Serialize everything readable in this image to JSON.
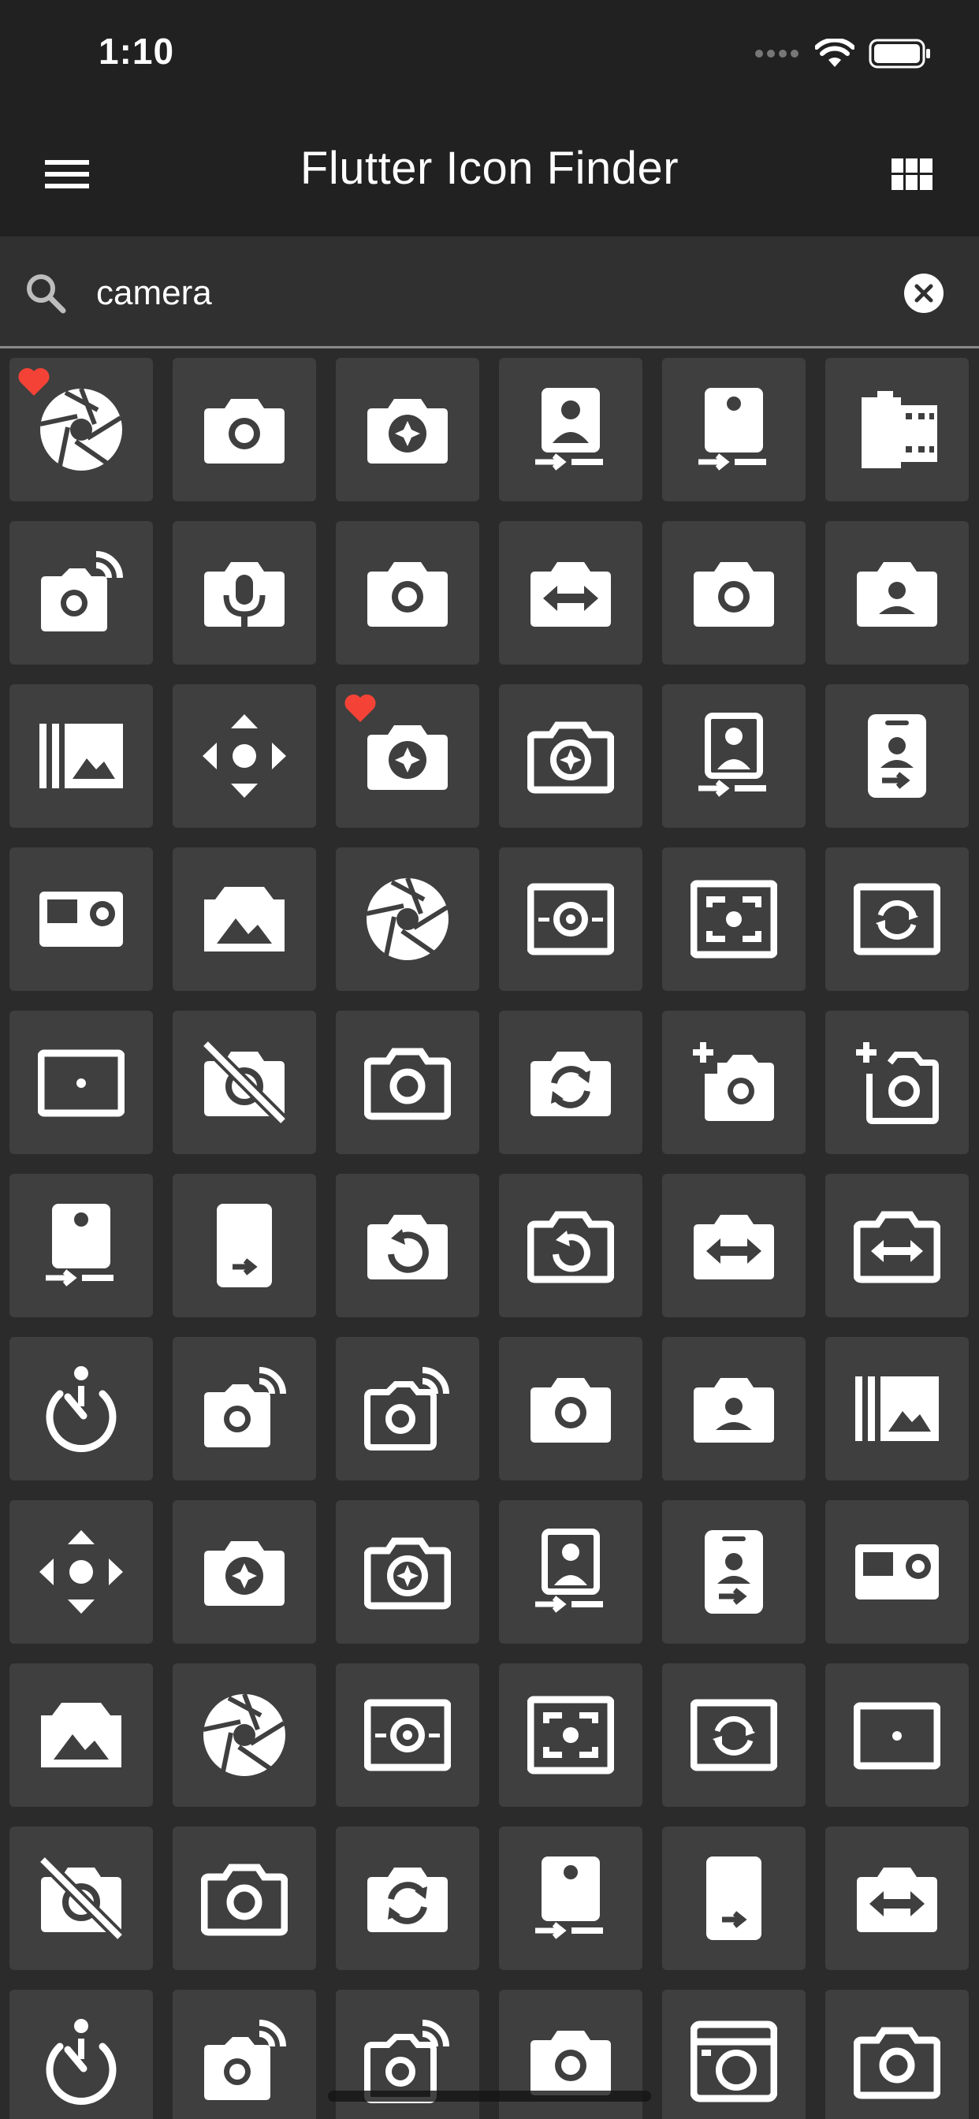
{
  "status_bar": {
    "time": "1:10"
  },
  "app_bar": {
    "title": "Flutter Icon Finder",
    "menu_icon": "menu-icon",
    "view_toggle_icon": "grid-view-icon"
  },
  "search": {
    "value": "camera",
    "placeholder": "",
    "search_icon": "search-icon",
    "clear_icon": "clear-icon"
  },
  "grid": {
    "columns": 6,
    "icons": [
      {
        "icon": "aperture",
        "favorite": true
      },
      {
        "icon": "camera-alt"
      },
      {
        "icon": "camera-enhance"
      },
      {
        "icon": "camera-front"
      },
      {
        "icon": "camera-rear"
      },
      {
        "icon": "camera-roll"
      },
      {
        "icon": "linked-camera"
      },
      {
        "icon": "mic-camera"
      },
      {
        "icon": "camera-alt"
      },
      {
        "icon": "switch-camera"
      },
      {
        "icon": "camera-alt"
      },
      {
        "icon": "account-box-camera"
      },
      {
        "icon": "burst-mode"
      },
      {
        "icon": "control-camera"
      },
      {
        "icon": "camera-enhance",
        "favorite": true
      },
      {
        "icon": "camera-enhance-outlined"
      },
      {
        "icon": "camera-front-outlined"
      },
      {
        "icon": "camera-front-badge"
      },
      {
        "icon": "action-camera"
      },
      {
        "icon": "panorama-photo"
      },
      {
        "icon": "aperture"
      },
      {
        "icon": "camera-indoor"
      },
      {
        "icon": "camera-outdoor-frame"
      },
      {
        "icon": "flip-camera-frame"
      },
      {
        "icon": "center-focus"
      },
      {
        "icon": "no-photography"
      },
      {
        "icon": "camera-outlined"
      },
      {
        "icon": "flip-camera"
      },
      {
        "icon": "add-a-photo"
      },
      {
        "icon": "add-a-photo-outlined"
      },
      {
        "icon": "camera-rear"
      },
      {
        "icon": "camera-rear-outlined"
      },
      {
        "icon": "cameraswitch"
      },
      {
        "icon": "cameraswitch-outlined"
      },
      {
        "icon": "switch-camera"
      },
      {
        "icon": "switch-camera-outlined"
      },
      {
        "icon": "shutter-timer"
      },
      {
        "icon": "linked-camera"
      },
      {
        "icon": "linked-camera-outlined"
      },
      {
        "icon": "camera-alt"
      },
      {
        "icon": "account-box-camera"
      },
      {
        "icon": "burst-mode"
      },
      {
        "icon": "control-camera"
      },
      {
        "icon": "camera-enhance"
      },
      {
        "icon": "camera-enhance-outlined"
      },
      {
        "icon": "camera-front-outlined"
      },
      {
        "icon": "camera-front-badge"
      },
      {
        "icon": "action-camera"
      },
      {
        "icon": "panorama-photo"
      },
      {
        "icon": "aperture"
      },
      {
        "icon": "camera-indoor"
      },
      {
        "icon": "camera-outdoor-frame"
      },
      {
        "icon": "flip-camera-frame"
      },
      {
        "icon": "center-focus"
      },
      {
        "icon": "no-photography"
      },
      {
        "icon": "camera-outlined"
      },
      {
        "icon": "flip-camera"
      },
      {
        "icon": "camera-rear"
      },
      {
        "icon": "camera-rear-outlined"
      },
      {
        "icon": "switch-camera"
      },
      {
        "icon": "shutter-timer"
      },
      {
        "icon": "linked-camera"
      },
      {
        "icon": "linked-camera-outlined"
      },
      {
        "icon": "camera-alt"
      },
      {
        "icon": "photo-camera-box"
      },
      {
        "icon": "camera-outlined"
      }
    ]
  },
  "colors": {
    "background": "#2b2b2b",
    "app_bar": "#212121",
    "tile": "#3f3f3f",
    "search_bar": "#303030",
    "favorite": "#f44336",
    "icon": "#ffffff"
  }
}
